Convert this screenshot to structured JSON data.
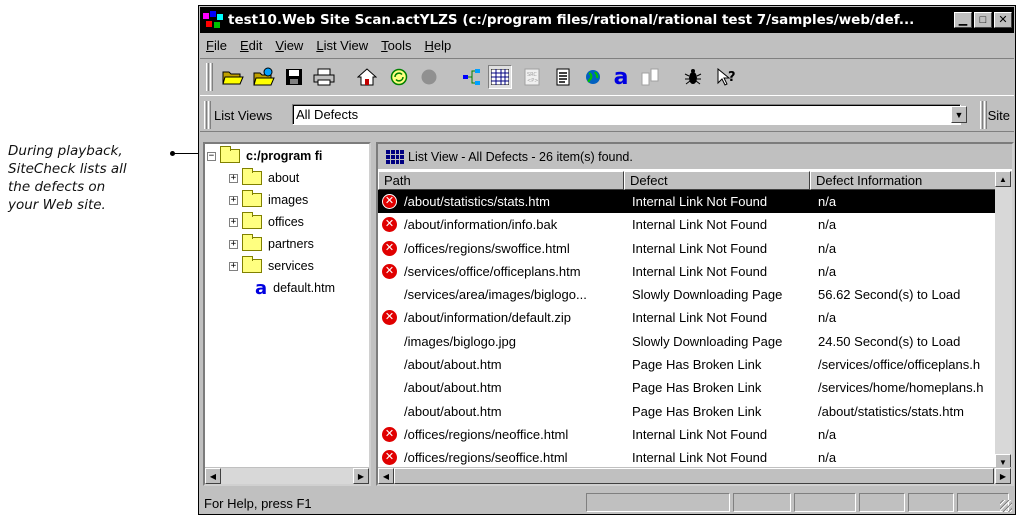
{
  "callout": {
    "lines": [
      "During playback,",
      "SiteCheck lists all",
      "the defects on",
      "your Web site."
    ]
  },
  "window": {
    "title": "test10.Web Site Scan.actYLZS (c:/program files/rational/rational test 7/samples/web/def...",
    "controls": {
      "minimize": "▁",
      "maximize": "□",
      "close": "✕"
    }
  },
  "menu": {
    "items": [
      {
        "label": "File",
        "mnemonic": "F"
      },
      {
        "label": "Edit",
        "mnemonic": "E"
      },
      {
        "label": "View",
        "mnemonic": "V"
      },
      {
        "label": "List View",
        "mnemonic": "L"
      },
      {
        "label": "Tools",
        "mnemonic": "T"
      },
      {
        "label": "Help",
        "mnemonic": "H"
      }
    ]
  },
  "toolbar": {
    "icons": [
      "open-folder-icon",
      "open-site-icon",
      "save-icon",
      "print-icon",
      "home-icon",
      "refresh-icon",
      "stop-icon",
      "tree-view-icon",
      "list-view-icon",
      "html-source-icon",
      "page-properties-icon",
      "web-icon",
      "text-icon",
      "compare-icon",
      "bug-icon",
      "context-help-icon"
    ]
  },
  "listViews": {
    "label": "List Views",
    "selected": "All Defects",
    "site_label": "Site"
  },
  "tree": {
    "root": "c:/program fi",
    "folders": [
      "about",
      "images",
      "offices",
      "partners",
      "services"
    ],
    "file": "default.htm"
  },
  "listPane": {
    "header": "List View - All Defects -  26 item(s) found.",
    "columns": [
      "Path",
      "Defect",
      "Defect Information"
    ],
    "rows": [
      {
        "path": "/about/statistics/stats.htm",
        "defect": "Internal Link Not Found",
        "info": "n/a",
        "error": true,
        "selected": true
      },
      {
        "path": "/about/information/info.bak",
        "defect": "Internal Link Not Found",
        "info": "n/a",
        "error": true
      },
      {
        "path": "/offices/regions/swoffice.html",
        "defect": "Internal Link Not Found",
        "info": "n/a",
        "error": true
      },
      {
        "path": "/services/office/officeplans.htm",
        "defect": "Internal Link Not Found",
        "info": "n/a",
        "error": true
      },
      {
        "path": "/services/area/images/biglogo...",
        "defect": "Slowly Downloading Page",
        "info": "56.62 Second(s) to Load",
        "error": false
      },
      {
        "path": "/about/information/default.zip",
        "defect": "Internal Link Not Found",
        "info": "n/a",
        "error": true
      },
      {
        "path": "/images/biglogo.jpg",
        "defect": "Slowly Downloading Page",
        "info": "24.50 Second(s) to Load",
        "error": false
      },
      {
        "path": "/about/about.htm",
        "defect": "Page Has Broken Link",
        "info": "/services/office/officeplans.h",
        "error": false
      },
      {
        "path": "/about/about.htm",
        "defect": "Page Has Broken Link",
        "info": "/services/home/homeplans.h",
        "error": false
      },
      {
        "path": "/about/about.htm",
        "defect": "Page Has Broken Link",
        "info": "/about/statistics/stats.htm",
        "error": false
      },
      {
        "path": "/offices/regions/neoffice.html",
        "defect": "Internal Link Not Found",
        "info": "n/a",
        "error": true
      },
      {
        "path": "/offices/regions/seoffice.html",
        "defect": "Internal Link Not Found",
        "info": "n/a",
        "error": true
      }
    ]
  },
  "status": {
    "text": "For Help, press F1"
  }
}
